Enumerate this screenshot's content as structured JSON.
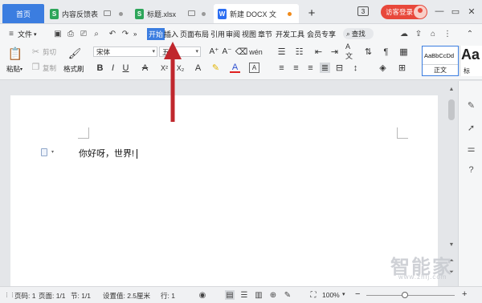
{
  "tabs": {
    "home": "首页",
    "items": [
      {
        "label": "内容反馈表",
        "icon": "S"
      },
      {
        "label": "标题.xlsx",
        "icon": "S"
      },
      {
        "label": "新建 DOCX 文",
        "icon": "W"
      }
    ],
    "add": "+",
    "window_count": "3",
    "visitor_login": "访客登录"
  },
  "menu": {
    "file": "文件",
    "more": "»",
    "items": [
      "开始",
      "插入",
      "页面布局",
      "引用",
      "审阅",
      "视图",
      "章节",
      "开发工具",
      "会员专享"
    ],
    "search": "查找"
  },
  "ribbon": {
    "paste": "粘贴",
    "cut": "剪切",
    "copy": "复制",
    "format_painter": "格式刷",
    "font_name": "宋体",
    "font_size": "五号",
    "style_preview": "AaBbCcDd",
    "style_name": "正文",
    "style2_preview": "Aa",
    "style2_name": "标"
  },
  "document": {
    "text": "你好呀，世界!"
  },
  "status": {
    "page_label": "页码: 1",
    "pages": "页面: 1/1",
    "section": "节: 1/1",
    "setting": "设置值: 2.5厘米",
    "row": "行: 1",
    "zoom": "100%",
    "zoom_minus": "−",
    "zoom_plus": "+"
  },
  "watermark": {
    "text": "智能家",
    "url": "www.zhij.com"
  },
  "colors": {
    "accent": "#3b7de0",
    "visitor": "#e8483b",
    "arrow": "#c0272d"
  }
}
